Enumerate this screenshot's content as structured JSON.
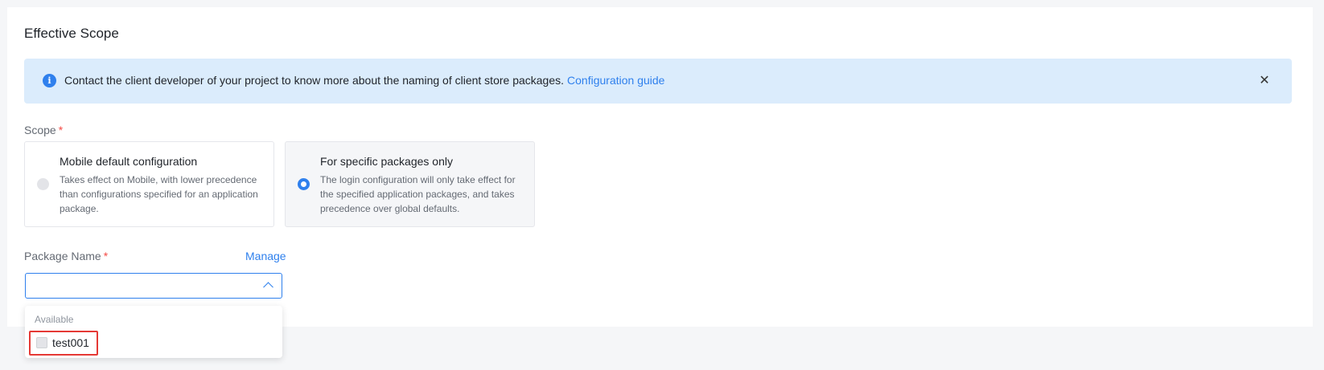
{
  "section": {
    "title": "Effective Scope"
  },
  "banner": {
    "icon": "info-icon",
    "text": "Contact the client developer of your project to know more about the naming of client store packages.",
    "link": "Configuration guide",
    "close_icon": "close-icon"
  },
  "scope": {
    "label": "Scope",
    "required_mark": "*",
    "options": [
      {
        "title": "Mobile default configuration",
        "description": "Takes effect on Mobile, with lower precedence than configurations specified for an application package.",
        "selected": false
      },
      {
        "title": "For specific packages only",
        "description": "The login configuration will only take effect for the specified application packages, and takes precedence over global defaults.",
        "selected": true
      }
    ]
  },
  "package": {
    "label": "Package Name",
    "required_mark": "*",
    "manage_link": "Manage",
    "select_value": "",
    "dropdown": {
      "group_label": "Available",
      "items": [
        {
          "label": "test001",
          "checked": false
        }
      ]
    }
  },
  "colors": {
    "accent": "#2f80ed",
    "banner_bg": "#dbecfc",
    "required": "#f54a45",
    "highlight_box": "#e53935"
  }
}
